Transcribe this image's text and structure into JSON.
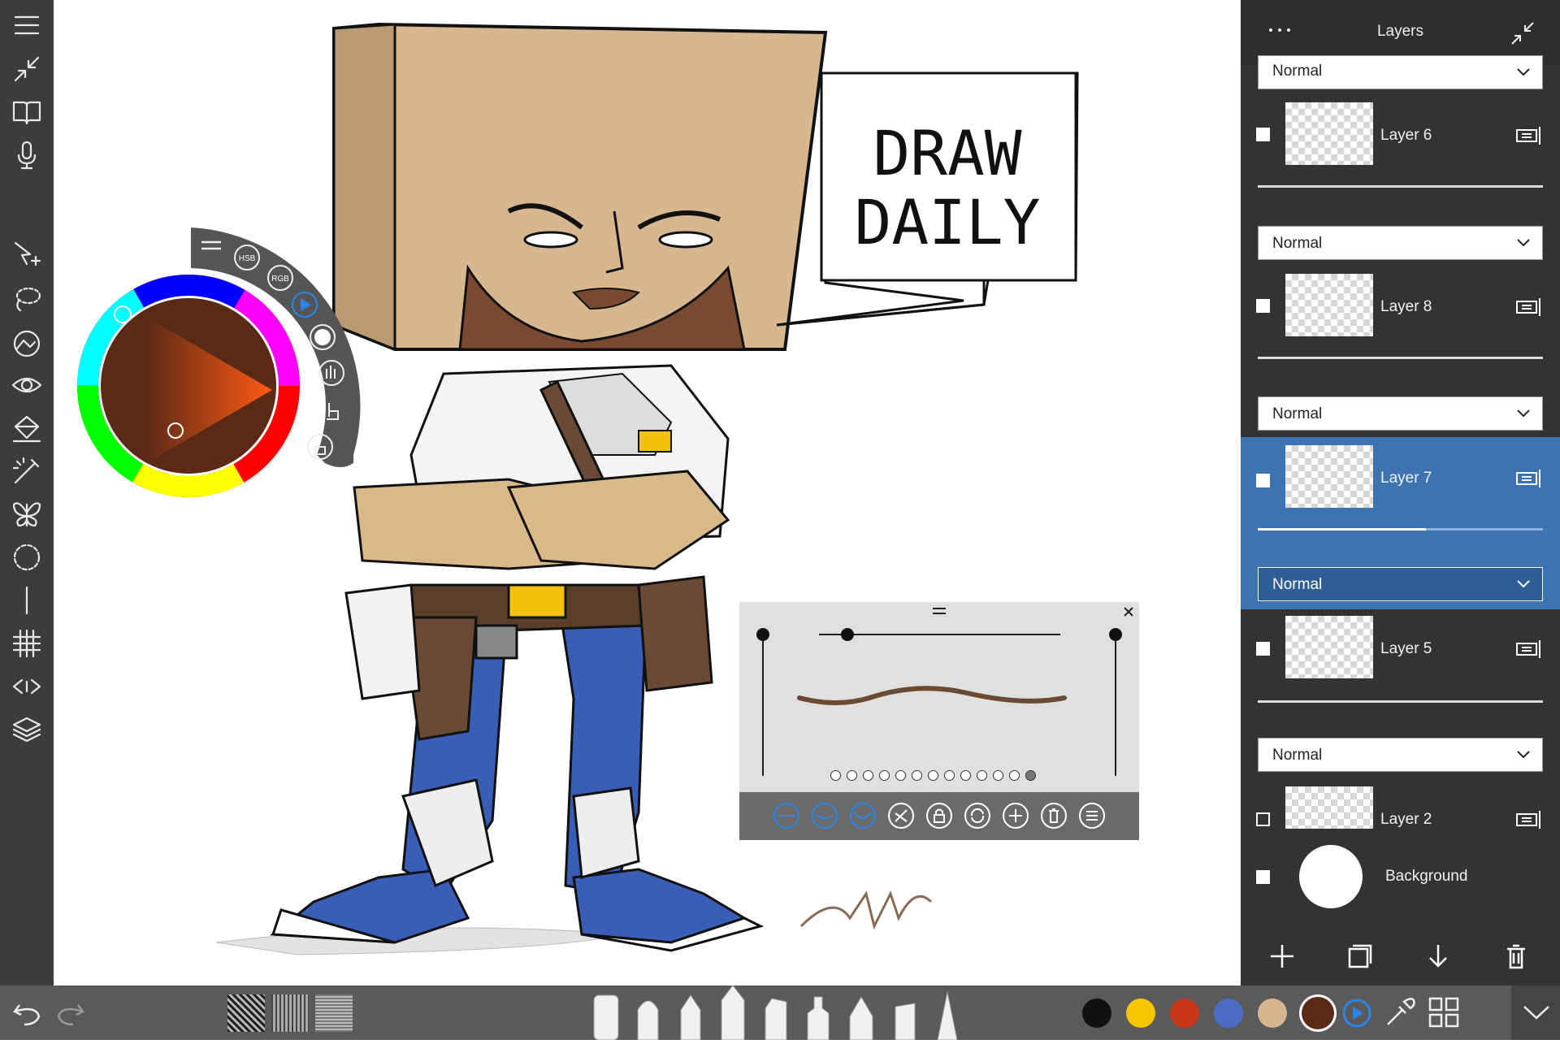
{
  "left_toolbar": {
    "tools": [
      "menu-icon",
      "collapse-icon",
      "reference-book-icon",
      "microphone-icon",
      "select-move-icon",
      "lasso-icon",
      "transform-icon",
      "eye-icon",
      "fill-bucket-icon",
      "magic-wand-icon",
      "symmetry-butterfly-icon",
      "ellipse-guide-icon",
      "ruler-icon",
      "grid-icon",
      "perspective-icon",
      "layers-icon"
    ]
  },
  "color_widget": {
    "hsb_label": "HSB",
    "rgb_label": "RGB",
    "current_color": "#5b2a16"
  },
  "canvas": {
    "speech_text_line1": "DRAW",
    "speech_text_line2": "DAILY"
  },
  "layers_panel": {
    "title": "Layers",
    "top_blend": "Normal",
    "layers": [
      {
        "name": "Layer 6",
        "blend": "Normal",
        "selected": false
      },
      {
        "name": "Layer 8",
        "blend": "Normal",
        "selected": false
      },
      {
        "name": "Layer 7",
        "blend": "Normal",
        "selected": true
      },
      {
        "name": "Layer 5",
        "blend": "Normal",
        "selected": false
      },
      {
        "name": "Layer 2",
        "blend": "",
        "selected": false
      }
    ],
    "background_label": "Background",
    "layer7_opacity": 0.59
  },
  "stroke_editor": {
    "preview_color": "#6b4a33",
    "dot_count": 13,
    "active_dot": 13
  },
  "bottom_bar": {
    "swatches": [
      "#111111",
      "#f7c600",
      "#c8391c",
      "#4b6bc6",
      "#d7b78f",
      "#5b2a16"
    ],
    "brushes": [
      "marker",
      "round-brush",
      "airbrush",
      "pen",
      "chisel-marker",
      "fine-liner",
      "nib-pen",
      "spray",
      "pencil"
    ]
  }
}
